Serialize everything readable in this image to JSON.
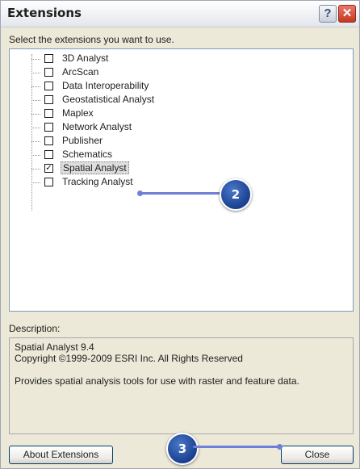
{
  "window": {
    "title": "Extensions",
    "help_button": "?",
    "close_button": "✕"
  },
  "prompt": "Select the extensions you want to use.",
  "extensions": [
    {
      "label": "3D Analyst",
      "checked": false
    },
    {
      "label": "ArcScan",
      "checked": false
    },
    {
      "label": "Data Interoperability",
      "checked": false
    },
    {
      "label": "Geostatistical Analyst",
      "checked": false
    },
    {
      "label": "Maplex",
      "checked": false
    },
    {
      "label": "Network Analyst",
      "checked": false
    },
    {
      "label": "Publisher",
      "checked": false
    },
    {
      "label": "Schematics",
      "checked": false
    },
    {
      "label": "Spatial Analyst",
      "checked": true,
      "selected": true
    },
    {
      "label": "Tracking Analyst",
      "checked": false
    }
  ],
  "description": {
    "label": "Description:",
    "line1": "Spatial Analyst 9.4",
    "line2": "Copyright ©1999-2009 ESRI Inc. All Rights Reserved",
    "line3": "Provides spatial analysis tools for use with raster and feature data."
  },
  "buttons": {
    "about": "About Extensions",
    "close": "Close"
  },
  "callouts": {
    "step2": "2",
    "step3": "3"
  },
  "colors": {
    "callout_line": "#6d7fd6",
    "callout_badge": "#1a3f8f"
  }
}
